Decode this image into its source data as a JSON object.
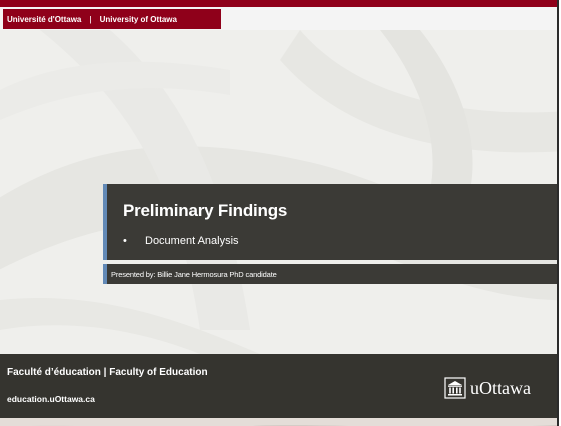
{
  "header": {
    "brand_fr": "Université d'Ottawa",
    "separator": "|",
    "brand_en": "University of Ottawa"
  },
  "slide": {
    "title": "Preliminary Findings",
    "bullet_symbol": "•",
    "bullet": "Document Analysis",
    "presenter": "Presented by: Billie Jane Hermosura PhD candidate"
  },
  "footer": {
    "faculty": "Faculté d’éducation  |  Faculty of Education",
    "website": "education.uOttawa.ca",
    "logo_text": "uOttawa",
    "logo_icon": "university-building-icon"
  },
  "colors": {
    "brand_red": "#8f001a",
    "panel_dark": "#3b3a36",
    "accent_blue": "#6289b6",
    "footer_dark": "#35342f"
  }
}
